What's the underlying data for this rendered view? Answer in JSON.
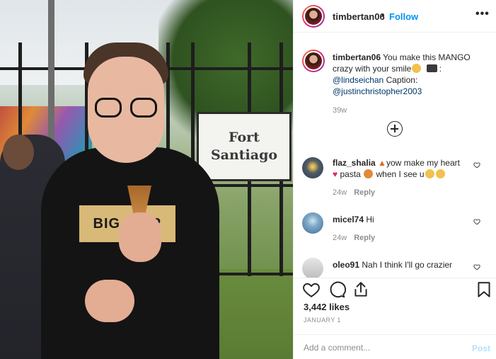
{
  "photo": {
    "sign_line1": "Fort",
    "sign_line2": "Santiago",
    "shirt_print": "BIG B   ER"
  },
  "header": {
    "username": "timbertan06",
    "separator": "•",
    "follow_label": "Follow",
    "more_label": "•••"
  },
  "caption": {
    "username": "timbertan06",
    "text_part1": "You make this MANGO crazy with your smile",
    "text_part2": ":",
    "mention1": "@lindseichan",
    "text_part3": "Caption:",
    "mention2": "@justinchristopher2003",
    "time": "39w"
  },
  "comments": [
    {
      "username": "flaz_shalia",
      "text_a": "yow make my heart",
      "text_b": "pasta",
      "text_c": "when I see u",
      "time": "24w",
      "reply": "Reply",
      "avatar_color": "#5b6f80"
    },
    {
      "username": "micel74",
      "text_a": "Hi",
      "time": "24w",
      "reply": "Reply",
      "avatar_color": "#5f8fb3"
    },
    {
      "username": "oleo91",
      "text_a": "Nah I think I'll go crazier",
      "avatar_color": "#d8d8d8"
    }
  ],
  "stats": {
    "likes": "3,442 likes",
    "date": "January 1"
  },
  "add_comment": {
    "placeholder": "Add a comment...",
    "post_label": "Post"
  },
  "colors": {
    "link": "#00376b",
    "follow": "#0095f6",
    "post_disabled": "#b2dffc",
    "meta_gray": "#8e8e8e"
  },
  "icons": [
    "heart-icon",
    "comment-icon",
    "share-icon",
    "bookmark-icon",
    "plus-circle-icon",
    "more-icon"
  ]
}
